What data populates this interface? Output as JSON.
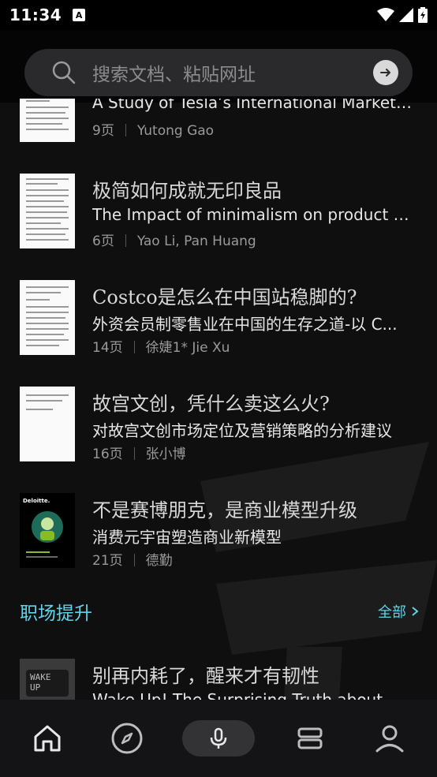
{
  "status": {
    "time": "11:34",
    "notification": "A"
  },
  "search": {
    "placeholder": "搜索文档、粘贴网址"
  },
  "docs": [
    {
      "title_cn": "",
      "subtitle": "A Study of Tesla’s International Marketing...",
      "pages": "9页",
      "author": "Yutong Gao"
    },
    {
      "title_cn": "极简如何成就无印良品",
      "subtitle": "The Impact of minimalism on product De...",
      "pages": "6页",
      "author": "Yao Li, Pan Huang"
    },
    {
      "title_cn": "Costco是怎么在中国站稳脚的?",
      "subtitle": "外资会员制零售业在中国的生存之道-以 C...",
      "pages": "14页",
      "author": "徐婕1* Jie Xu"
    },
    {
      "title_cn": "故宫文创，凭什么卖这么火?",
      "subtitle": "对故宫文创市场定位及营销策略的分析建议",
      "pages": "16页",
      "author": "张小博"
    },
    {
      "title_cn": "不是赛博朋克，是商业模型升级",
      "subtitle": "消费元宇宙塑造商业新模型",
      "pages": "21页",
      "author": "德勤"
    }
  ],
  "section": {
    "title": "职场提升",
    "all_label": "全部"
  },
  "next_doc": {
    "title_cn": "别再内耗了，醒来才有韧性",
    "subtitle": "Wake Up! The Surprising Truth about Wha",
    "thumb_text": "WAKE UP"
  },
  "deloitte_thumb": {
    "brand": "Deloitte."
  },
  "colors": {
    "accent": "#5fd3e8",
    "background": "#0f0f10",
    "nav_background": "#141416"
  },
  "nav": {
    "icons": [
      "home-icon",
      "compass-icon",
      "microphone-icon",
      "stack-icon",
      "profile-icon"
    ]
  }
}
